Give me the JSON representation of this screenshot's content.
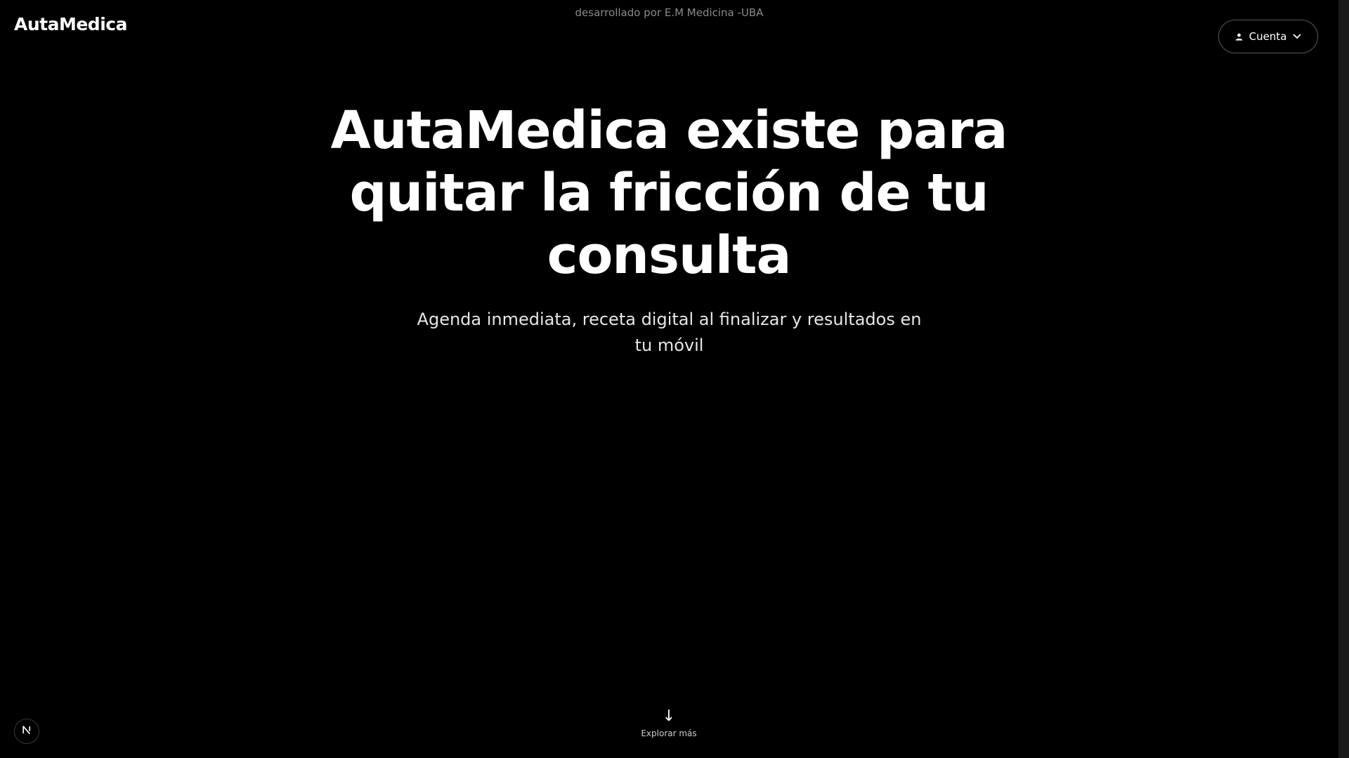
{
  "header": {
    "logo": "AutaMedica",
    "credit": "desarrollado por E.M Medicina -UBA",
    "account_button": {
      "label": "Cuenta",
      "icon": "user-icon",
      "chevron": "chevron-down-icon"
    }
  },
  "hero": {
    "title": "AutaMedica existe para quitar la fricción de tu consulta",
    "subtitle": "Agenda inmediata, receta digital al finalizar y resultados en tu móvil"
  },
  "explore": {
    "arrow": "↓",
    "label": "Explorar más"
  },
  "dev_badge": {
    "icon": "nextjs-n-icon"
  },
  "colors": {
    "background": "#000000",
    "text": "#ffffff",
    "muted": "#8a8a8a",
    "button_border": "#5a5a5a"
  }
}
